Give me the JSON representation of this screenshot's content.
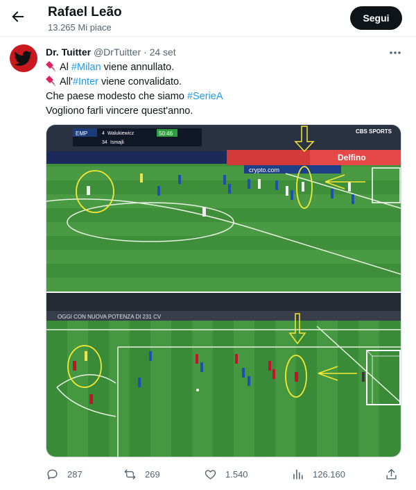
{
  "header": {
    "title": "Rafael Leão",
    "subtitle": "13.265 Mi piace",
    "follow_label": "Segui"
  },
  "tweet": {
    "author_name": "Dr. Tuitter",
    "handle": "@DrTuitter",
    "separator": "·",
    "date": "24 set",
    "lines": [
      {
        "prefix": "Al ",
        "tag": "#Milan",
        "suffix": " viene annullato."
      },
      {
        "prefix": "All'",
        "tag": "#Inter",
        "suffix": " viene convalidato."
      },
      {
        "prefix": "Che paese modesto che siamo ",
        "tag": "#SerieA",
        "suffix": ""
      },
      {
        "prefix": "Vogliono farli vincere quest'anno.",
        "tag": "",
        "suffix": ""
      }
    ]
  },
  "media": {
    "top": {
      "scoreboard_team": "EMP",
      "player1_num": "4",
      "player1": "Walukiewicz",
      "player2_num": "34",
      "player2": "Ismajli",
      "clock": "50:46",
      "broadcaster": "CBS SPORTS",
      "board_text_1": "Delfino",
      "board_text_2": "crypto.com"
    },
    "bottom": {
      "board_text": "OGGI CON NUOVA POTENZA DI 231 CV"
    }
  },
  "actions": {
    "replies": "287",
    "reposts": "269",
    "likes": "1.540",
    "views": "126.160"
  },
  "colors": {
    "accent": "#1d9bf0",
    "follow_bg": "#0f1419",
    "secondary_text": "#536471",
    "avatar_bg": "#c9191e"
  }
}
